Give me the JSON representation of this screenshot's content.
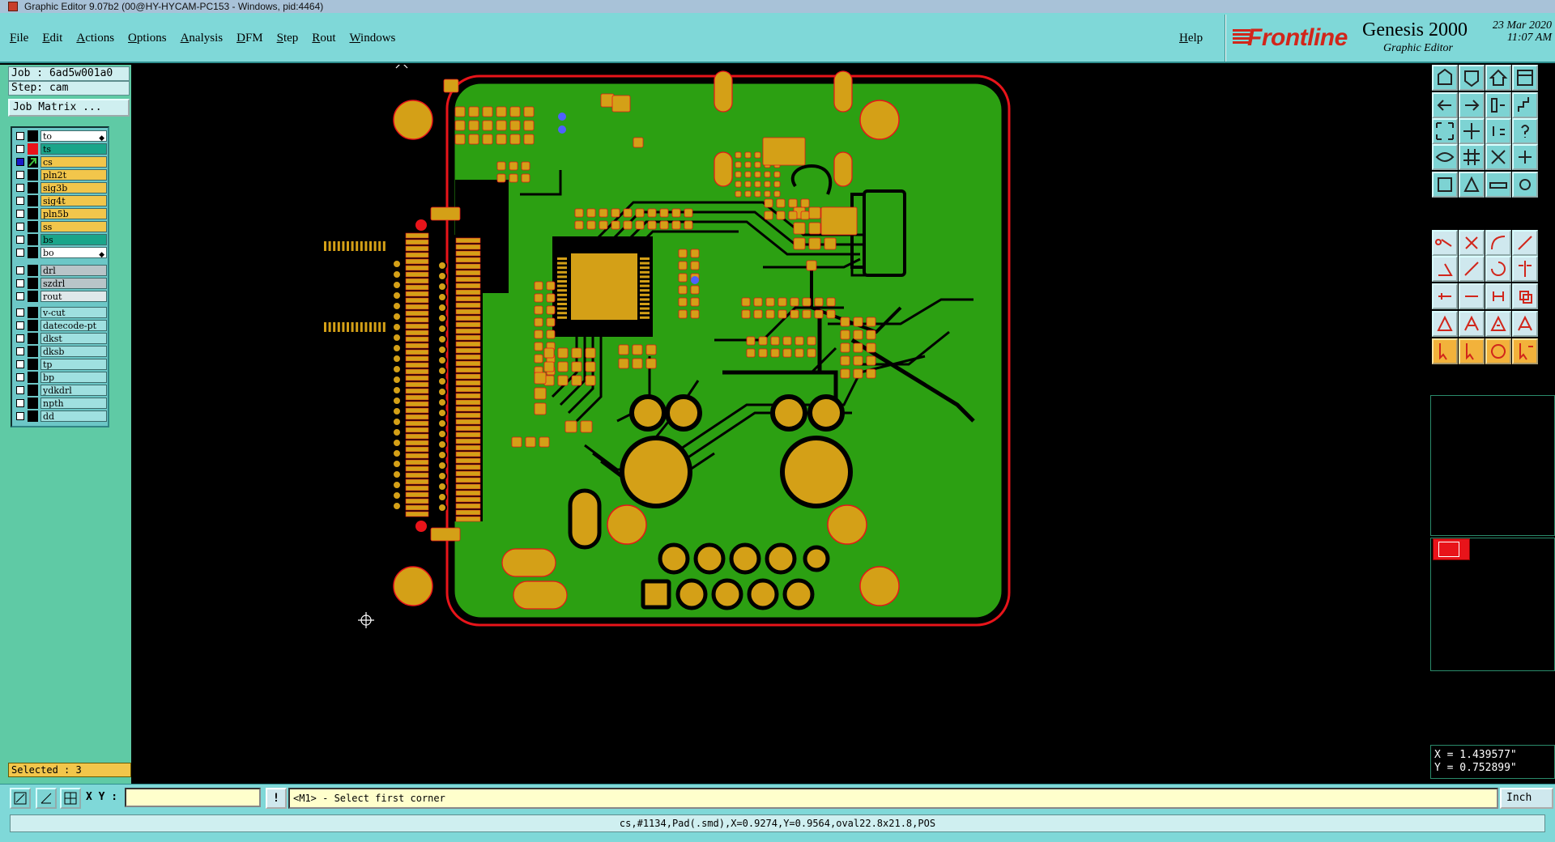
{
  "window": {
    "title": "Graphic Editor 9.07b2 (00@HY-HYCAM-PC153 - Windows, pid:4464)"
  },
  "menu": {
    "items": [
      "File",
      "Edit",
      "Actions",
      "Options",
      "Analysis",
      "DFM",
      "Step",
      "Rout",
      "Windows"
    ],
    "help": "Help"
  },
  "brand": {
    "logo": "Frontline",
    "product": "Genesis 2000",
    "subtitle": "Graphic Editor",
    "date": "23 Mar 2020",
    "time": "11:07 AM"
  },
  "left_panel": {
    "job": "Job : 6ad5w001a0",
    "step": "Step: cam",
    "job_matrix_button": "Job Matrix ...",
    "layer_groups": [
      [
        {
          "name": "to",
          "color": "#ffffff",
          "swatch": "#000000",
          "checked": false,
          "arrow": true
        },
        {
          "name": "ts",
          "color": "#1aa58a",
          "swatch": "#e8141a",
          "checked": false
        },
        {
          "name": "cs",
          "color": "#f2c64b",
          "swatch": "#000000",
          "checked": true,
          "active": true
        },
        {
          "name": "pln2t",
          "color": "#f2c64b",
          "swatch": "#000000",
          "checked": false
        },
        {
          "name": "sig3b",
          "color": "#f2c64b",
          "swatch": "#000000",
          "checked": false
        },
        {
          "name": "sig4t",
          "color": "#f2c64b",
          "swatch": "#000000",
          "checked": false
        },
        {
          "name": "pln5b",
          "color": "#f2c64b",
          "swatch": "#000000",
          "checked": false
        },
        {
          "name": "ss",
          "color": "#f2c64b",
          "swatch": "#000000",
          "checked": false
        },
        {
          "name": "bs",
          "color": "#1aa58a",
          "swatch": "#000000",
          "checked": false
        },
        {
          "name": "bo",
          "color": "#ffffff",
          "swatch": "#000000",
          "checked": false,
          "arrow": true
        }
      ],
      [
        {
          "name": "drl",
          "color": "#b8c4c8",
          "swatch": "#000000",
          "checked": false
        },
        {
          "name": "szdrl",
          "color": "#b8c4c8",
          "swatch": "#000000",
          "checked": false
        },
        {
          "name": "rout",
          "color": "#dfe8ea",
          "swatch": "#000000",
          "checked": false
        }
      ],
      [
        {
          "name": "v-cut",
          "color": "#9fe0e0",
          "swatch": "#000000",
          "checked": false
        },
        {
          "name": "datecode-pt",
          "color": "#9fe0e0",
          "swatch": "#000000",
          "checked": false
        },
        {
          "name": "dkst",
          "color": "#9fe0e0",
          "swatch": "#000000",
          "checked": false
        },
        {
          "name": "dksb",
          "color": "#9fe0e0",
          "swatch": "#000000",
          "checked": false
        },
        {
          "name": "tp",
          "color": "#9fe0e0",
          "swatch": "#000000",
          "checked": false
        },
        {
          "name": "bp",
          "color": "#9fe0e0",
          "swatch": "#000000",
          "checked": false
        },
        {
          "name": "ydkdrl",
          "color": "#9fe0e0",
          "swatch": "#000000",
          "checked": false
        },
        {
          "name": "npth",
          "color": "#9fe0e0",
          "swatch": "#000000",
          "checked": false
        },
        {
          "name": "dd",
          "color": "#9fe0e0",
          "swatch": "#000000",
          "checked": false
        }
      ]
    ],
    "selected": "Selected : 3"
  },
  "right_panel": {
    "coord_x": "X = 1.439577\"",
    "coord_y": "Y = 0.752899\""
  },
  "command_bar": {
    "xy_label": "X Y :",
    "xy_value": "",
    "warn": "!",
    "prompt": "<M1> - Select first corner",
    "units": "Inch"
  },
  "status": {
    "text": "cs,#1134,Pad(.smd),X=0.9274,Y=0.9564,oval22.8x21.8,POS"
  },
  "colors": {
    "board": "#2ca012",
    "copper": "#d4a017",
    "outline": "#e8141a",
    "panel": "#7fd8d8",
    "canvas": "#000000"
  }
}
